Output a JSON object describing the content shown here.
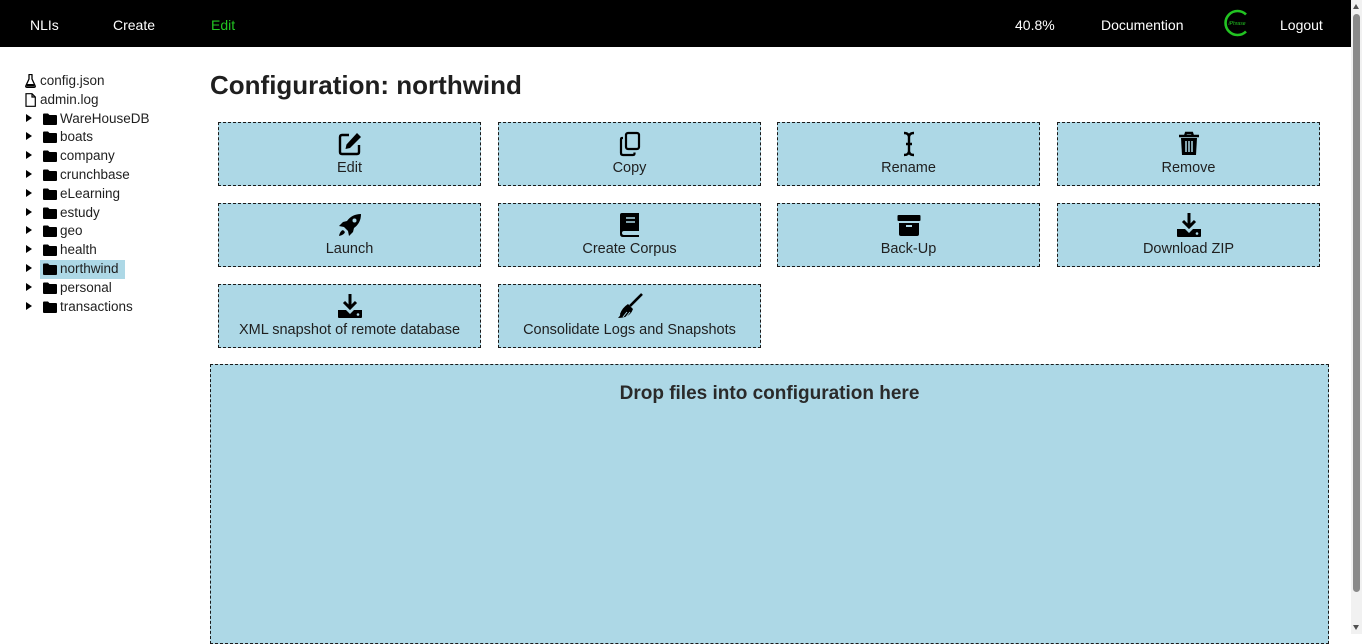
{
  "nav": {
    "left": [
      {
        "label": "NLIs",
        "active": false
      },
      {
        "label": "Create",
        "active": false
      },
      {
        "label": "Edit",
        "active": true
      }
    ],
    "progress": "40.8%",
    "documentation": "Documention",
    "logout": "Logout",
    "logo_text": "iPhrase",
    "active_color": "#22c322"
  },
  "tree": {
    "files": [
      {
        "label": "config.json",
        "icon": "flask-icon"
      },
      {
        "label": "admin.log",
        "icon": "file-icon"
      }
    ],
    "folders": [
      {
        "label": "WareHouseDB",
        "selected": false
      },
      {
        "label": "boats",
        "selected": false
      },
      {
        "label": "company",
        "selected": false
      },
      {
        "label": "crunchbase",
        "selected": false
      },
      {
        "label": "eLearning",
        "selected": false
      },
      {
        "label": "estudy",
        "selected": false
      },
      {
        "label": "geo",
        "selected": false
      },
      {
        "label": "health",
        "selected": false
      },
      {
        "label": "northwind",
        "selected": true
      },
      {
        "label": "personal",
        "selected": false
      },
      {
        "label": "transactions",
        "selected": false
      }
    ]
  },
  "main": {
    "title": "Configuration: northwind",
    "actions": [
      {
        "label": "Edit",
        "icon": "edit-icon"
      },
      {
        "label": "Copy",
        "icon": "copy-icon"
      },
      {
        "label": "Rename",
        "icon": "text-cursor-icon"
      },
      {
        "label": "Remove",
        "icon": "trash-icon"
      },
      {
        "label": "Launch",
        "icon": "rocket-icon"
      },
      {
        "label": "Create Corpus",
        "icon": "book-icon"
      },
      {
        "label": "Back-Up",
        "icon": "archive-icon"
      },
      {
        "label": "Download ZIP",
        "icon": "download-icon"
      },
      {
        "label": "XML snapshot of remote database",
        "icon": "download-icon"
      },
      {
        "label": "Consolidate Logs and Snapshots",
        "icon": "broom-icon"
      }
    ],
    "dropzone": "Drop files into configuration here"
  },
  "colors": {
    "button_bg": "#add8e6",
    "topbar_bg": "#000000"
  }
}
